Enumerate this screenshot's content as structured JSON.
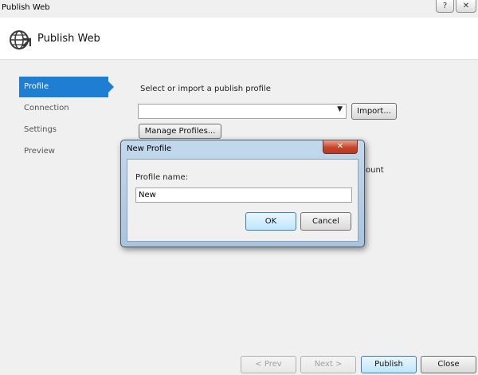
{
  "window": {
    "title": "Publish Web",
    "help_glyph": "?",
    "close_glyph": "✕"
  },
  "header": {
    "title": "Publish Web"
  },
  "nav": {
    "items": [
      {
        "label": "Profile",
        "active": true
      },
      {
        "label": "Connection",
        "active": false
      },
      {
        "label": "Settings",
        "active": false
      },
      {
        "label": "Preview",
        "active": false
      }
    ]
  },
  "profile_page": {
    "prompt": "Select or import a publish profile",
    "profile_select_value": "",
    "dropdown_glyph": "▼",
    "import_label": "Import...",
    "manage_profiles_label": "Manage Profiles...",
    "partial_text": "ount"
  },
  "footer": {
    "prev_label": "< Prev",
    "next_label": "Next >",
    "publish_label": "Publish",
    "close_label": "Close"
  },
  "dialog": {
    "title": "New Profile",
    "close_glyph": "✕",
    "field_label": "Profile name:",
    "field_value": "New",
    "ok_label": "OK",
    "cancel_label": "Cancel"
  },
  "colors": {
    "accent": "#1e7fd2",
    "dialog_frame": "#b6cfe8",
    "close_red": "#c7442a"
  }
}
